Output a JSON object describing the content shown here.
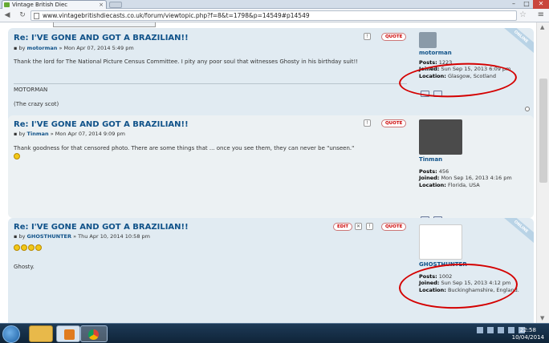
{
  "browser": {
    "tab_title": "Vintage British Diec",
    "url": "www.vintagebritishdiecasts.co.uk/forum/viewtopic.php?f=8&t=1798&p=14549#p14549"
  },
  "posts": [
    {
      "title": "Re: I'VE GONE AND GOT A BRAZILIAN!!",
      "by": "by",
      "author": "motorman",
      "date": "» Mon Apr 07, 2014 5:49 pm",
      "body": "Thank the lord for The National Picture Census Committee. I pity any poor soul that witnesses Ghosty in his birthday suit!!",
      "sig_name": "MOTORMAN",
      "sig_tag": "(The crazy scot)",
      "quote_label": "QUOTE",
      "online_label": "ONLINE",
      "username": "motorman",
      "posts_label": "Posts:",
      "posts_value": "1223",
      "joined_label": "Joined:",
      "joined_value": "Sun Sep 15, 2013 6:09 pm",
      "location_label": "Location:",
      "location_value": "Glasgow, Scotland"
    },
    {
      "title": "Re: I'VE GONE AND GOT A BRAZILIAN!!",
      "by": "by",
      "author": "Tinman",
      "date": "» Mon Apr 07, 2014 9:09 pm",
      "body": "Thank goodness for that censored photo. There are some things that ... once you see them, they can never be \"unseen.\"",
      "quote_label": "QUOTE",
      "username": "Tinman",
      "posts_label": "Posts:",
      "posts_value": "456",
      "joined_label": "Joined:",
      "joined_value": "Mon Sep 16, 2013 4:16 pm",
      "location_label": "Location:",
      "location_value": "Florida, USA"
    },
    {
      "title": "Re: I'VE GONE AND GOT A BRAZILIAN!!",
      "by": "by",
      "author": "GHOSTHUNTER",
      "date": "» Thu Apr 10, 2014 10:58 pm",
      "body": "Ghosty.",
      "edit_label": "EDIT",
      "quote_label": "QUOTE",
      "online_label": "ONLINE",
      "username": "GHOSTHUNTER",
      "posts_label": "Posts:",
      "posts_value": "1002",
      "joined_label": "Joined:",
      "joined_value": "Sun Sep 15, 2013 4:12 pm",
      "location_label": "Location:",
      "location_value": "Buckinghamshire, England."
    }
  ],
  "taskbar": {
    "time": "22:58",
    "date": "10/04/2014"
  },
  "colors": {
    "post_bg_a": "#e1ebf2",
    "post_bg_b": "#ecf1f3",
    "title_blue": "#105289",
    "highlight_red": "#d40000"
  }
}
